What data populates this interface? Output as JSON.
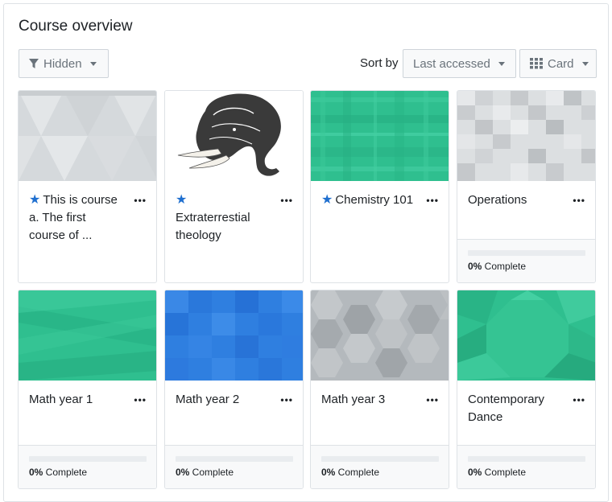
{
  "panel": {
    "title": "Course overview"
  },
  "controls": {
    "filter_label": "Hidden",
    "sort_by_label": "Sort by",
    "sort_value": "Last accessed",
    "view_label": "Card"
  },
  "courses": [
    {
      "name": "This is course a. The first course of ...",
      "starred": true,
      "show_progress": false,
      "progress_percent": "",
      "progress_suffix": ""
    },
    {
      "name": "Extraterrestial theology",
      "starred": true,
      "show_progress": false,
      "progress_percent": "",
      "progress_suffix": ""
    },
    {
      "name": "Chemistry 101",
      "starred": true,
      "show_progress": false,
      "progress_percent": "",
      "progress_suffix": ""
    },
    {
      "name": "Operations",
      "starred": false,
      "show_progress": true,
      "progress_percent": "0%",
      "progress_suffix": " Complete",
      "progress_value": 0
    },
    {
      "name": "Math year 1",
      "starred": false,
      "show_progress": true,
      "progress_percent": "0%",
      "progress_suffix": " Complete",
      "progress_value": 0
    },
    {
      "name": "Math year 2",
      "starred": false,
      "show_progress": true,
      "progress_percent": "0%",
      "progress_suffix": " Complete",
      "progress_value": 0
    },
    {
      "name": "Math year 3",
      "starred": false,
      "show_progress": true,
      "progress_percent": "0%",
      "progress_suffix": " Complete",
      "progress_value": 0
    },
    {
      "name": "Contemporary Dance",
      "starred": false,
      "show_progress": true,
      "progress_percent": "0%",
      "progress_suffix": " Complete",
      "progress_value": 0
    }
  ],
  "colors": {
    "star": "#1f6fcf",
    "green": "#2fbf8f",
    "blue": "#2f7fe0",
    "grey": "#d7dadd"
  }
}
